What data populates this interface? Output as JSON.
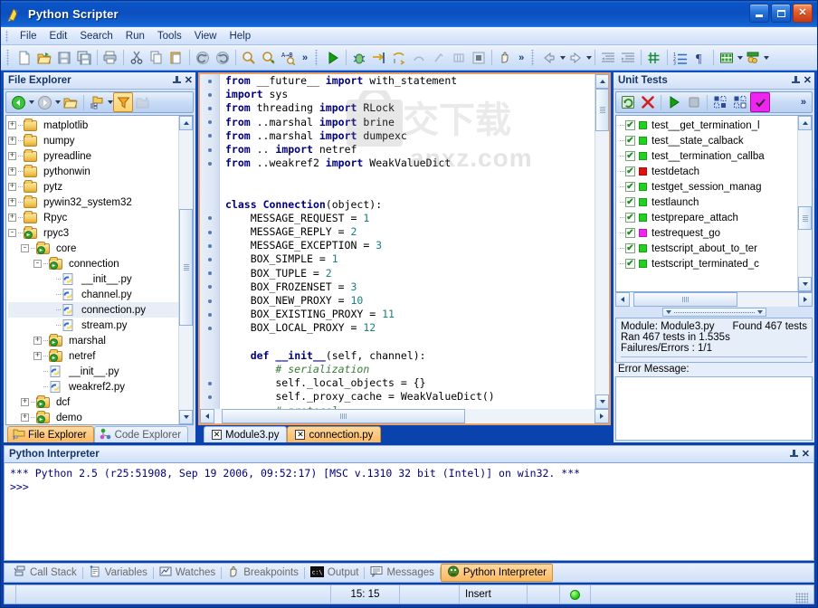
{
  "window": {
    "title": "Python Scripter",
    "app_icon": "python-script-icon",
    "buttons": {
      "minimize": "minimize-icon",
      "maximize": "maximize-icon",
      "close": "close-icon"
    }
  },
  "menu": {
    "items": [
      "File",
      "Edit",
      "Search",
      "Run",
      "Tools",
      "View",
      "Help"
    ]
  },
  "toolbar": {
    "groups": [
      {
        "name": "standard",
        "items": [
          "new-file-icon",
          "open-file-icon",
          "save-icon",
          "save-all-icon",
          "sep",
          "print-icon",
          "sep",
          "cut-icon",
          "copy-icon",
          "paste-icon",
          "sep",
          "undo-icon",
          "redo-icon",
          "sep",
          "find-icon",
          "find-next-icon",
          "replace-icon",
          "overflow-chevron"
        ]
      },
      {
        "name": "run",
        "items": [
          "run-icon",
          "sep",
          "debug-icon",
          "step-into-icon",
          "step-over-icon",
          "step-out-icon",
          "run-to-cursor-icon",
          "toggle-breakpoint-icon",
          "stop-icon",
          "sep",
          "pause-hand-icon",
          "overflow-chevron"
        ]
      },
      {
        "name": "editor",
        "items": [
          "back-icon",
          "back-dropdown",
          "forward-icon",
          "forward-dropdown",
          "sep",
          "unindent-icon",
          "indent-icon",
          "sep",
          "toggle-comment-icon",
          "sep",
          "line-numbers-icon",
          "paragraph-marks-icon",
          "sep",
          "layout-icon",
          "layout-dropdown",
          "theme-icon",
          "theme-dropdown"
        ]
      }
    ],
    "overflow_label": "»"
  },
  "file_explorer": {
    "title": "File Explorer",
    "pin_icon": "pin-icon",
    "close_icon": "close-icon",
    "toolbar": [
      "back-icon",
      "back-dropdown",
      "forward-icon",
      "forward-dropdown",
      "open-folder-icon",
      "sep",
      "browse-folder-icon",
      "browse-dropdown",
      "filter-icon",
      "explore-icon"
    ],
    "tree": [
      {
        "label": "matplotlib",
        "indent": 0,
        "expander": "+",
        "icon": "folder-icon"
      },
      {
        "label": "numpy",
        "indent": 0,
        "expander": "+",
        "icon": "folder-icon"
      },
      {
        "label": "pyreadline",
        "indent": 0,
        "expander": "+",
        "icon": "folder-icon"
      },
      {
        "label": "pythonwin",
        "indent": 0,
        "expander": "+",
        "icon": "folder-icon"
      },
      {
        "label": "pytz",
        "indent": 0,
        "expander": "+",
        "icon": "folder-icon"
      },
      {
        "label": "pywin32_system32",
        "indent": 0,
        "expander": "+",
        "icon": "folder-icon"
      },
      {
        "label": "Rpyc",
        "indent": 0,
        "expander": "+",
        "icon": "folder-icon"
      },
      {
        "label": "rpyc3",
        "indent": 0,
        "expander": "-",
        "icon": "folder-python-icon"
      },
      {
        "label": "core",
        "indent": 1,
        "expander": "-",
        "icon": "folder-python-icon"
      },
      {
        "label": "connection",
        "indent": 2,
        "expander": "-",
        "icon": "folder-python-icon"
      },
      {
        "label": "__init__.py",
        "indent": 3,
        "expander": "",
        "icon": "python-file-icon"
      },
      {
        "label": "channel.py",
        "indent": 3,
        "expander": "",
        "icon": "python-file-icon"
      },
      {
        "label": "connection.py",
        "indent": 3,
        "expander": "",
        "icon": "python-file-icon",
        "selected": true
      },
      {
        "label": "stream.py",
        "indent": 3,
        "expander": "",
        "icon": "python-file-icon"
      },
      {
        "label": "marshal",
        "indent": 2,
        "expander": "+",
        "icon": "folder-python-icon"
      },
      {
        "label": "netref",
        "indent": 2,
        "expander": "+",
        "icon": "folder-python-icon"
      },
      {
        "label": "__init__.py",
        "indent": 2,
        "expander": "",
        "icon": "python-file-icon"
      },
      {
        "label": "weakref2.py",
        "indent": 2,
        "expander": "",
        "icon": "python-file-icon"
      },
      {
        "label": "dcf",
        "indent": 1,
        "expander": "+",
        "icon": "folder-python-icon"
      },
      {
        "label": "demo",
        "indent": 1,
        "expander": "+",
        "icon": "folder-python-icon"
      }
    ],
    "tabs": [
      {
        "label": "File Explorer",
        "icon": "file-explorer-icon",
        "active": true
      },
      {
        "label": "Code Explorer",
        "icon": "code-explorer-icon",
        "active": false
      }
    ]
  },
  "editor": {
    "tabs": [
      {
        "label": "Module3.py",
        "active": false,
        "close_icon": "close-icon"
      },
      {
        "label": "connection.py",
        "active": true,
        "close_icon": "close-icon"
      }
    ],
    "watermark": {
      "text": "anxz.com",
      "logo": "chinese-download-logo"
    },
    "lines": [
      {
        "dot": true,
        "html": "<span class=\"kw\">from</span> __future__ <span class=\"kw\">import</span> with_statement"
      },
      {
        "dot": true,
        "html": "<span class=\"kw\">import</span> sys"
      },
      {
        "dot": true,
        "html": "<span class=\"kw\">from</span> threading <span class=\"kw\">import</span> RLock"
      },
      {
        "dot": true,
        "html": "<span class=\"kw\">from</span> ..marshal <span class=\"kw\">import</span> brine"
      },
      {
        "dot": true,
        "html": "<span class=\"kw\">from</span> ..marshal <span class=\"kw\">import</span> dumpexc"
      },
      {
        "dot": true,
        "html": "<span class=\"kw\">from</span> .. <span class=\"kw\">import</span> netref"
      },
      {
        "dot": true,
        "html": "<span class=\"kw\">from</span> ..weakref2 <span class=\"kw\">import</span> WeakValueDict"
      },
      {
        "dot": false,
        "html": ""
      },
      {
        "dot": false,
        "html": ""
      },
      {
        "dot": false,
        "html": "<span class=\"kw\">class</span> <span class=\"cls\">Connection</span>(object):"
      },
      {
        "dot": true,
        "html": "    MESSAGE_REQUEST = <span class=\"num\">1</span>"
      },
      {
        "dot": true,
        "html": "    MESSAGE_REPLY = <span class=\"num\">2</span>"
      },
      {
        "dot": true,
        "html": "    MESSAGE_EXCEPTION = <span class=\"num\">3</span>"
      },
      {
        "dot": true,
        "html": "    BOX_SIMPLE = <span class=\"num\">1</span>"
      },
      {
        "dot": true,
        "html": "    BOX_TUPLE = <span class=\"num\">2</span>"
      },
      {
        "dot": true,
        "html": "    BOX_FROZENSET = <span class=\"num\">3</span>"
      },
      {
        "dot": true,
        "html": "    BOX_NEW_PROXY = <span class=\"num\">10</span>"
      },
      {
        "dot": true,
        "html": "    BOX_EXISTING_PROXY = <span class=\"num\">11</span>"
      },
      {
        "dot": true,
        "html": "    BOX_LOCAL_PROXY = <span class=\"num\">12</span>"
      },
      {
        "dot": false,
        "html": ""
      },
      {
        "dot": false,
        "html": "    <span class=\"kw\">def</span> <span class=\"cls\">__init__</span>(self, channel):"
      },
      {
        "dot": false,
        "html": "        <span class=\"cmt\"># serialization</span>"
      },
      {
        "dot": true,
        "html": "        self._local_objects = {}"
      },
      {
        "dot": true,
        "html": "        self._proxy_cache = WeakValueDict()"
      },
      {
        "dot": false,
        "html": "        <span class=\"cmt\"># protocol</span>"
      }
    ]
  },
  "unit_tests": {
    "title": "Unit Tests",
    "pin_icon": "pin-icon",
    "close_icon": "close-icon",
    "toolbar": [
      "refresh-icon",
      "clear-icon",
      "sep",
      "run-tests-icon",
      "stop-tests-icon",
      "sep",
      "select-all-icon",
      "deselect-all-icon",
      "select-failed-icon",
      "overflow-chevron"
    ],
    "tests": [
      {
        "label": "test__get_termination_l",
        "checked": true,
        "status": "pass",
        "status_color": "#22d022"
      },
      {
        "label": "test__state_calback",
        "checked": true,
        "status": "pass",
        "status_color": "#22d022"
      },
      {
        "label": "test__termination_callba",
        "checked": true,
        "status": "pass",
        "status_color": "#22d022"
      },
      {
        "label": "testdetach",
        "checked": true,
        "status": "fail",
        "status_color": "#e01010"
      },
      {
        "label": "testget_session_manag",
        "checked": true,
        "status": "pass",
        "status_color": "#22d022"
      },
      {
        "label": "testlaunch",
        "checked": true,
        "status": "pass",
        "status_color": "#22d022"
      },
      {
        "label": "testprepare_attach",
        "checked": true,
        "status": "pass",
        "status_color": "#22d022"
      },
      {
        "label": "testrequest_go",
        "checked": true,
        "status": "error",
        "status_color": "#ef25ef"
      },
      {
        "label": "testscript_about_to_ter",
        "checked": true,
        "status": "pass",
        "status_color": "#22d022"
      },
      {
        "label": "testscript_terminated_c",
        "checked": true,
        "status": "pass",
        "status_color": "#22d022"
      }
    ],
    "summary": {
      "module": "Module: Module3.py",
      "found": "Found 467 tests",
      "ran": "Ran 467 tests in 1.535s",
      "failures": "Failures/Errors : 1/1"
    },
    "error_label": "Error Message:",
    "error_text": ""
  },
  "interpreter": {
    "title": "Python Interpreter",
    "pin_icon": "pin-icon",
    "close_icon": "close-icon",
    "lines": [
      "*** Python 2.5 (r25:51908, Sep 19 2006, 09:52:17) [MSC v.1310 32 bit (Intel)] on win32. ***",
      ">>>"
    ]
  },
  "bottom_tabs": [
    {
      "label": "Call Stack",
      "icon": "call-stack-icon",
      "active": false
    },
    {
      "label": "Variables",
      "icon": "variables-icon",
      "active": false
    },
    {
      "label": "Watches",
      "icon": "watches-icon",
      "active": false
    },
    {
      "label": "Breakpoints",
      "icon": "breakpoints-icon",
      "active": false
    },
    {
      "label": "Output",
      "icon": "output-icon",
      "active": false
    },
    {
      "label": "Messages",
      "icon": "messages-icon",
      "active": false
    },
    {
      "label": "Python Interpreter",
      "icon": "python-icon",
      "active": true
    }
  ],
  "status_bar": {
    "cells": [
      "",
      "15: 15",
      "",
      "Insert",
      "",
      "",
      ""
    ],
    "cursor_position": "15: 15",
    "insert_mode": "Insert",
    "indicator": "green-status-dot"
  },
  "colors": {
    "accent_orange": "#fbb860",
    "title_blue": "#0b4fc0",
    "panel_blue": "#d6e3f7",
    "pass_green": "#22d022",
    "fail_red": "#e01010",
    "error_magenta": "#ef25ef"
  }
}
